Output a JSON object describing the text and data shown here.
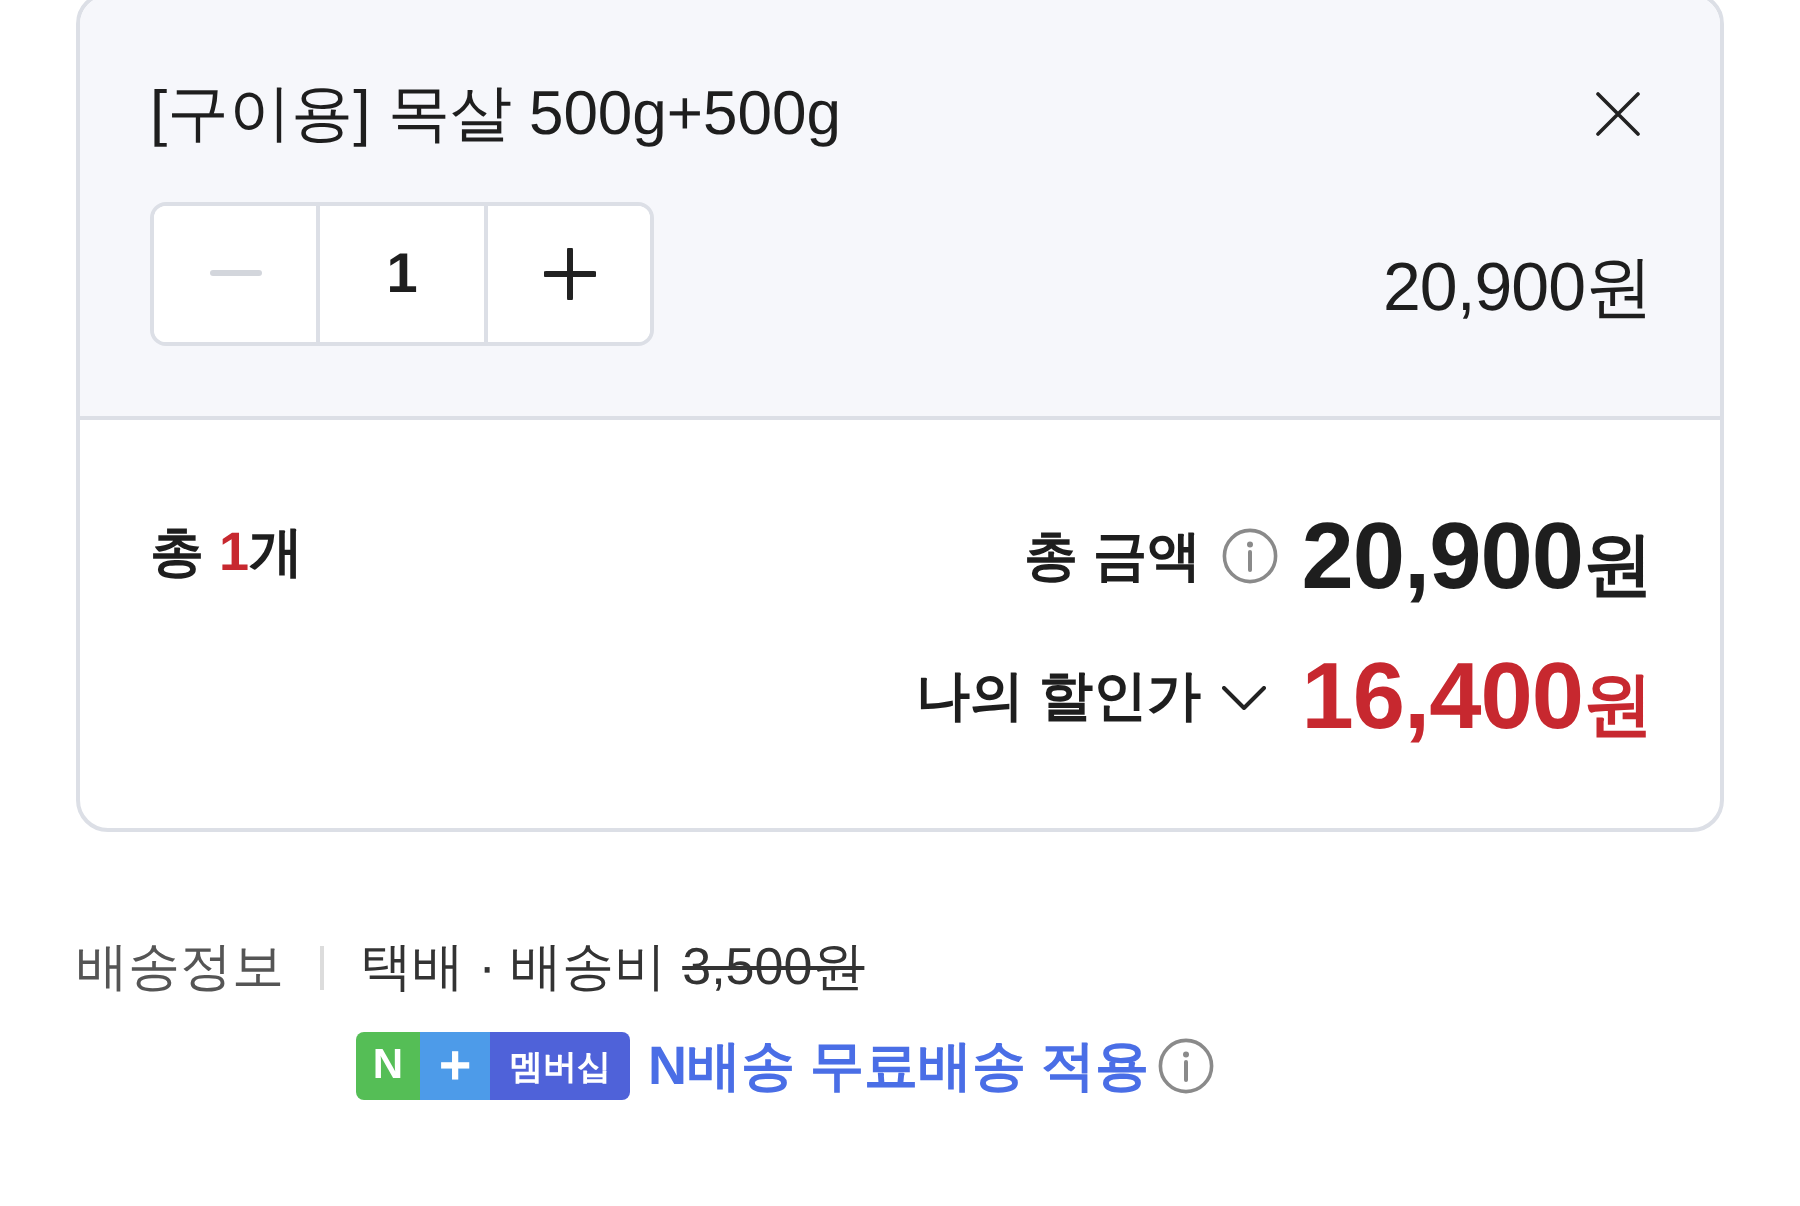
{
  "product": {
    "title": "[구이용] 목살 500g+500g",
    "quantity": "1",
    "price": "20,900원",
    "decrease_disabled": true,
    "increase_disabled": false
  },
  "summary": {
    "count_label": "총",
    "count": "1",
    "count_unit": "개",
    "total_label": "총 금액",
    "total_value": "20,900",
    "total_unit": "원",
    "discount_label": "나의 할인가",
    "discount_expanded": false,
    "discount_value": "16,400",
    "discount_unit": "원"
  },
  "delivery": {
    "label": "배송정보",
    "shipping_text": "택배 · 배송비",
    "fee": "3,500원",
    "fee_struck": true,
    "badge": {
      "logo": "N",
      "plus": "+",
      "name": "멤버십"
    },
    "benefit": "N배송 무료배송 적용"
  }
}
